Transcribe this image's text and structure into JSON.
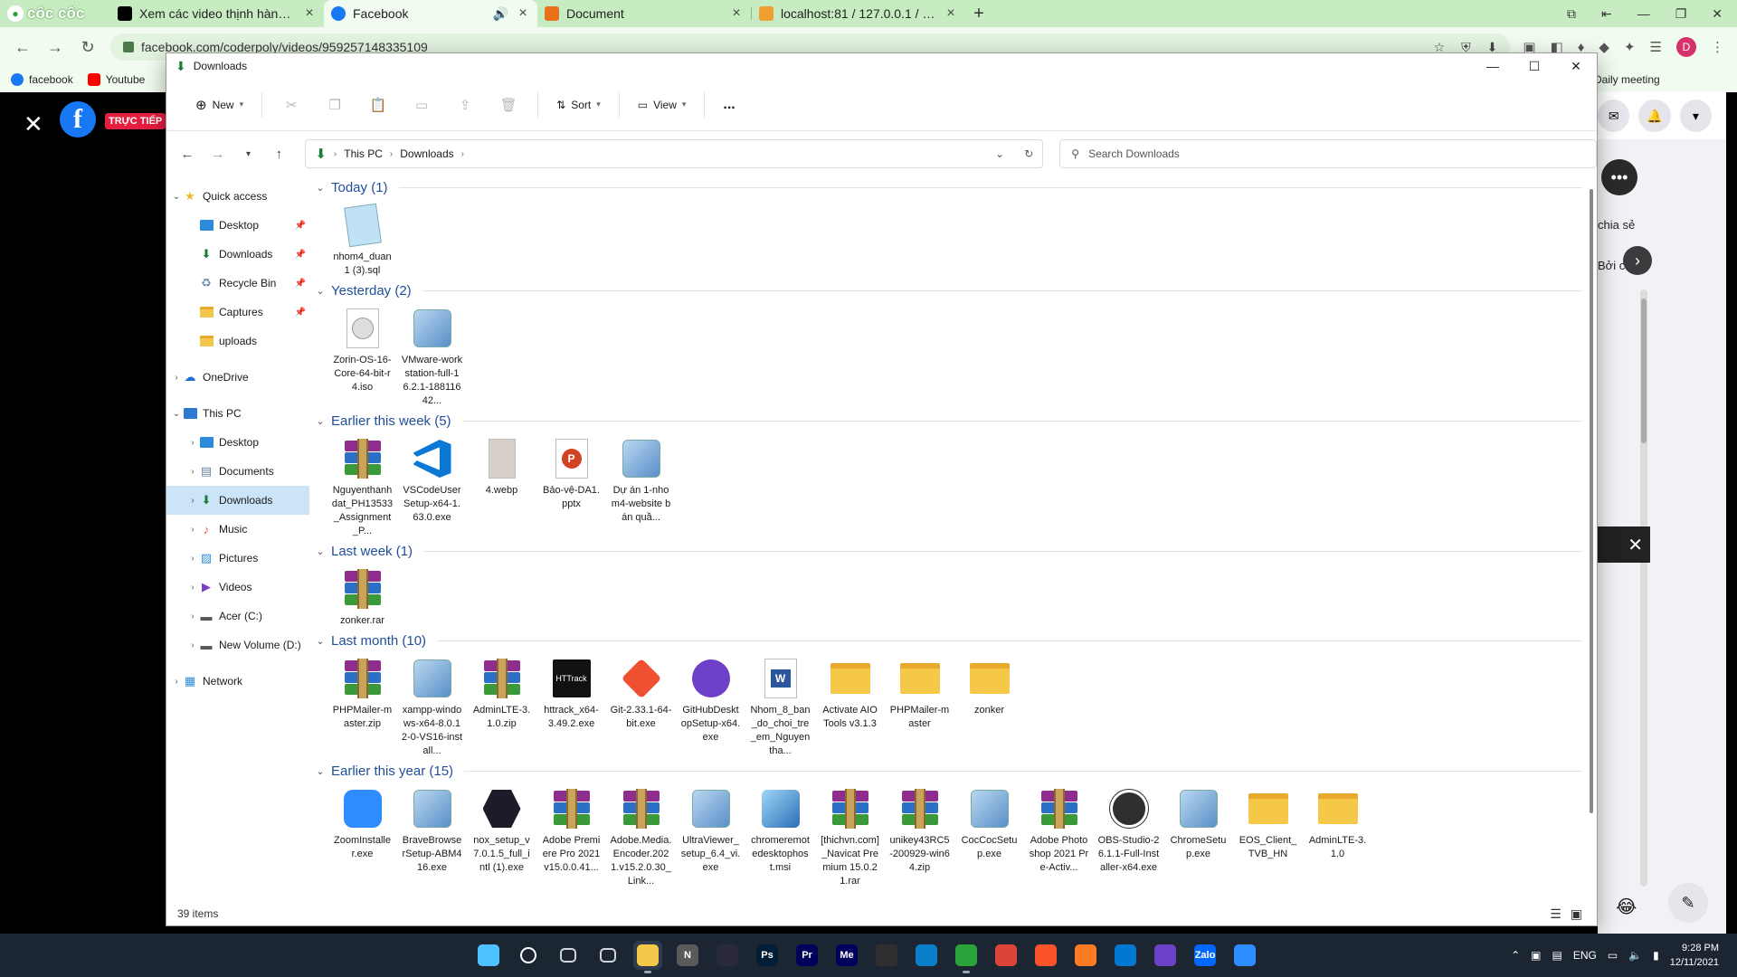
{
  "browser": {
    "brand": "cốc cốc",
    "tabs": [
      {
        "title": "Xem các video thịnh hành d",
        "fav_color": "#000000"
      },
      {
        "title": "Facebook",
        "fav_color": "#1877f2"
      },
      {
        "title": "Document",
        "fav_color": "#e8711a"
      },
      {
        "title": "localhost:81 / 127.0.0.1 / nho",
        "fav_color": "#f0a030"
      }
    ],
    "url": "facebook.com/coderpoly/videos/959257148335109",
    "bookmarks": [
      {
        "label": "facebook",
        "color": "#1877f2"
      },
      {
        "label": "Youtube",
        "color": "#ff0000"
      }
    ],
    "bookmark_right": "Daily meeting",
    "avatar_letter": "D"
  },
  "facebook": {
    "live_badge": "TRỰC TIẾP",
    "side_text_1": "chia sẻ",
    "side_text_2": "Bởi c",
    "logo": "f"
  },
  "explorer": {
    "title": "Downloads",
    "toolbar": {
      "new_label": "New",
      "sort_label": "Sort",
      "view_label": "View",
      "more_label": "..."
    },
    "breadcrumb": [
      "This PC",
      "Downloads"
    ],
    "search_placeholder": "Search Downloads",
    "status": "39 items",
    "sidebar": [
      {
        "label": "Quick access",
        "icon": "star-icon",
        "level": 0,
        "expanded": true
      },
      {
        "label": "Desktop",
        "icon": "desktop-icon",
        "level": 1,
        "pinned": true
      },
      {
        "label": "Downloads",
        "icon": "download-icon",
        "level": 1,
        "pinned": true
      },
      {
        "label": "Recycle Bin",
        "icon": "recycle-bin-icon",
        "level": 1,
        "pinned": true
      },
      {
        "label": "Captures",
        "icon": "folder-icon",
        "level": 1,
        "pinned": true
      },
      {
        "label": "uploads",
        "icon": "folder-icon",
        "level": 1,
        "pinned": false
      },
      {
        "label": "OneDrive",
        "icon": "cloud-icon",
        "level": 0,
        "expanded": false
      },
      {
        "label": "This PC",
        "icon": "pc-icon",
        "level": 0,
        "expanded": true
      },
      {
        "label": "Desktop",
        "icon": "desktop-icon",
        "level": 1
      },
      {
        "label": "Documents",
        "icon": "documents-icon",
        "level": 1
      },
      {
        "label": "Downloads",
        "icon": "download-icon",
        "level": 1,
        "selected": true
      },
      {
        "label": "Music",
        "icon": "music-icon",
        "level": 1
      },
      {
        "label": "Pictures",
        "icon": "pictures-icon",
        "level": 1
      },
      {
        "label": "Videos",
        "icon": "videos-icon",
        "level": 1
      },
      {
        "label": "Acer (C:)",
        "icon": "drive-icon",
        "level": 1
      },
      {
        "label": "New Volume (D:)",
        "icon": "drive-icon",
        "level": 1
      },
      {
        "label": "Network",
        "icon": "network-icon",
        "level": 0,
        "expanded": false
      }
    ],
    "groups": [
      {
        "title": "Today (1)",
        "items": [
          {
            "name": "nhom4_duan1 (3).sql",
            "icon": "notepad-icon"
          }
        ]
      },
      {
        "title": "Yesterday (2)",
        "items": [
          {
            "name": "Zorin-OS-16-Core-64-bit-r4.iso",
            "icon": "disc-image-icon"
          },
          {
            "name": "VMware-workstation-full-16.2.1-18811642...",
            "icon": "installer-icon"
          }
        ]
      },
      {
        "title": "Earlier this week (5)",
        "items": [
          {
            "name": "Nguyenthanhdat_PH13533_Assignment_P...",
            "icon": "winrar-icon"
          },
          {
            "name": "VSCodeUserSetup-x64-1.63.0.exe",
            "icon": "vscode-icon"
          },
          {
            "name": "4.webp",
            "icon": "photo-icon"
          },
          {
            "name": "Bảo-vệ-DA1.pptx",
            "icon": "powerpoint-icon"
          },
          {
            "name": "Dự án 1-nhom4-website bán quầ...",
            "icon": "installer-icon"
          }
        ]
      },
      {
        "title": "Last week (1)",
        "items": [
          {
            "name": "zonker.rar",
            "icon": "winrar-icon"
          }
        ]
      },
      {
        "title": "Last month (10)",
        "items": [
          {
            "name": "PHPMailer-master.zip",
            "icon": "winrar-icon"
          },
          {
            "name": "xampp-windows-x64-8.0.12-0-VS16-install...",
            "icon": "installer-icon"
          },
          {
            "name": "AdminLTE-3.1.0.zip",
            "icon": "winrar-icon"
          },
          {
            "name": "httrack_x64-3.49.2.exe",
            "icon": "httrack-icon"
          },
          {
            "name": "Git-2.33.1-64-bit.exe",
            "icon": "git-icon"
          },
          {
            "name": "GitHubDesktopSetup-x64.exe",
            "icon": "github-icon"
          },
          {
            "name": "Nhom_8_ban_do_choi_tre_em_Nguyentha...",
            "icon": "word-icon"
          },
          {
            "name": "Activate AIO Tools v3.1.3",
            "icon": "folder-icon"
          },
          {
            "name": "PHPMailer-master",
            "icon": "folder-icon"
          },
          {
            "name": "zonker",
            "icon": "folder-icon"
          }
        ]
      },
      {
        "title": "Earlier this year (15)",
        "items": [
          {
            "name": "ZoomInstaller.exe",
            "icon": "zoom-icon"
          },
          {
            "name": "BraveBrowserSetup-ABM416.exe",
            "icon": "installer-icon"
          },
          {
            "name": "nox_setup_v7.0.1.5_full_intl (1).exe",
            "icon": "nox-icon"
          },
          {
            "name": "Adobe Premiere Pro 2021 v15.0.0.41...",
            "icon": "winrar-icon"
          },
          {
            "name": "Adobe.Media.Encoder.2021.v15.2.0.30_Link...",
            "icon": "winrar-icon"
          },
          {
            "name": "UltraViewer_setup_6.4_vi.exe",
            "icon": "installer-icon"
          },
          {
            "name": "chromeremotedesktophost.msi",
            "icon": "msi-icon"
          },
          {
            "name": "[thichvn.com]_Navicat Premium 15.0.21.rar",
            "icon": "winrar-icon"
          },
          {
            "name": "unikey43RC5-200929-win64.zip",
            "icon": "winrar-icon"
          },
          {
            "name": "CocCocSetup.exe",
            "icon": "installer-icon"
          },
          {
            "name": "Adobe Photoshop 2021 Pre-Activ...",
            "icon": "winrar-icon"
          },
          {
            "name": "OBS-Studio-26.1.1-Full-Installer-x64.exe",
            "icon": "obs-icon"
          },
          {
            "name": "ChromeSetup.exe",
            "icon": "installer-icon"
          },
          {
            "name": "EOS_Client_TVB_HN",
            "icon": "folder-icon"
          },
          {
            "name": "AdminLTE-3.1.0",
            "icon": "folder-icon"
          }
        ]
      }
    ]
  },
  "taskbar": {
    "apps": [
      {
        "name": "start",
        "label": "",
        "color": "#4cc2ff"
      },
      {
        "name": "search",
        "label": "",
        "color": "transparent"
      },
      {
        "name": "task-view",
        "label": "",
        "color": "transparent"
      },
      {
        "name": "widgets",
        "label": "",
        "color": "transparent"
      },
      {
        "name": "file-explorer",
        "label": "",
        "color": "#f3c74a",
        "active": true
      },
      {
        "name": "notepad",
        "label": "N",
        "color": "#5a5a5a"
      },
      {
        "name": "nox",
        "label": "",
        "color": "#2a2a3a"
      },
      {
        "name": "photoshop",
        "label": "Ps",
        "color": "#001e36"
      },
      {
        "name": "premiere",
        "label": "Pr",
        "color": "#00005b"
      },
      {
        "name": "media-encoder",
        "label": "Me",
        "color": "#00005b"
      },
      {
        "name": "obs",
        "label": "",
        "color": "#302e31"
      },
      {
        "name": "edge",
        "label": "",
        "color": "#0c7dc7"
      },
      {
        "name": "coccoc",
        "label": "",
        "color": "#2aa33b",
        "running": true
      },
      {
        "name": "chrome",
        "label": "",
        "color": "#db4437"
      },
      {
        "name": "brave",
        "label": "",
        "color": "#fb542b"
      },
      {
        "name": "xampp",
        "label": "",
        "color": "#fb7a24"
      },
      {
        "name": "vscode",
        "label": "",
        "color": "#0078d4"
      },
      {
        "name": "github",
        "label": "",
        "color": "#6e40c9"
      },
      {
        "name": "zalo",
        "label": "Zalo",
        "color": "#0068ff"
      },
      {
        "name": "zoom",
        "label": "",
        "color": "#2d8cff"
      }
    ],
    "language": "ENG",
    "time": "9:28 PM",
    "date": "12/11/2021"
  }
}
